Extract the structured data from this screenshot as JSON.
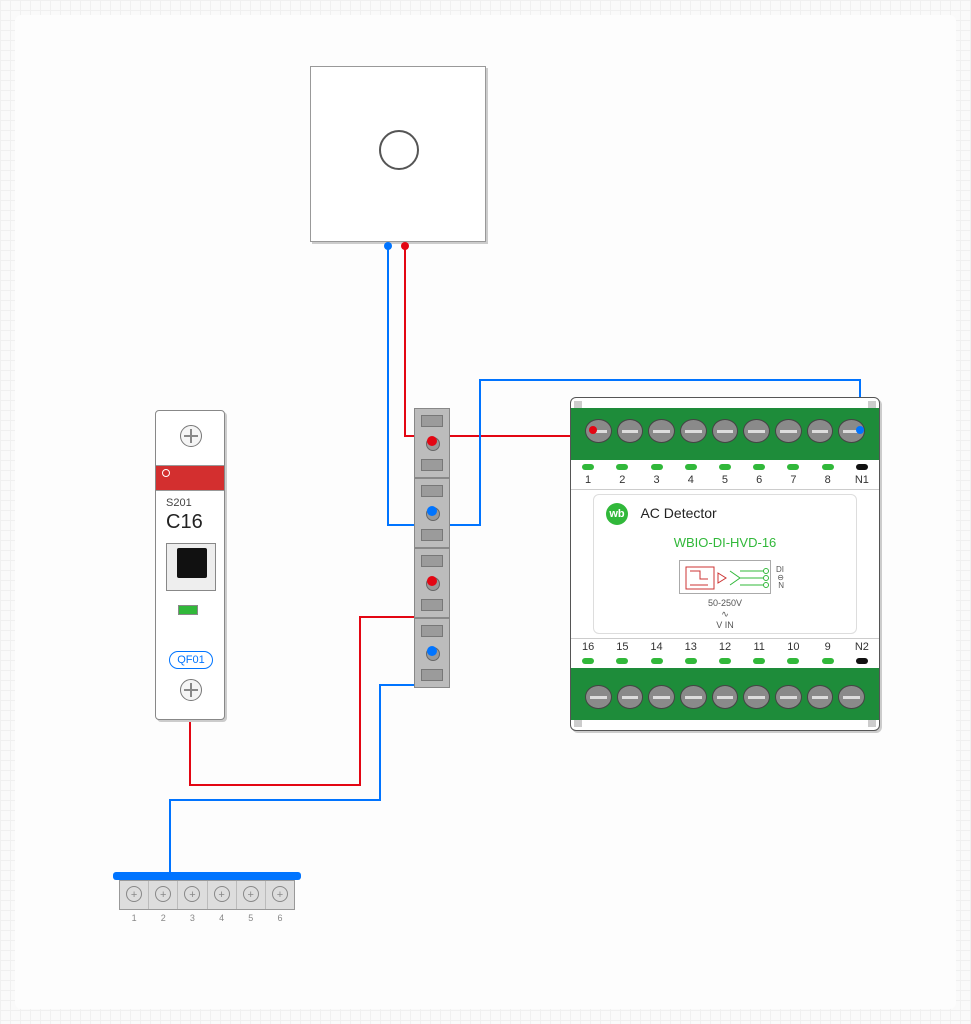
{
  "breaker": {
    "series": "S201",
    "rating": "C16",
    "tag": "QF01"
  },
  "wbio": {
    "logo": "wb",
    "title": "AC Detector",
    "model": "WBIO-DI-HVD-16",
    "voltage_range": "50-250V",
    "ac_symbol": "∿",
    "vin_label": "V IN",
    "opto_labels": {
      "di": "DI",
      "minus": "⊖",
      "n": "N"
    },
    "top_terminals": [
      "1",
      "2",
      "3",
      "4",
      "5",
      "6",
      "7",
      "8",
      "N1"
    ],
    "bottom_terminals": [
      "16",
      "15",
      "14",
      "13",
      "12",
      "11",
      "10",
      "9",
      "N2"
    ]
  },
  "busbar": {
    "positions": [
      "1",
      "2",
      "3",
      "4",
      "5",
      "6"
    ]
  },
  "wiring": {
    "description": "Illustrative wiring: circuit breaker QF01 feeds phase (red) to DIN pass-through terminals; push-button switch (top box) switches phase to WBIO-DI-HVD-16 input 1; neutral (blue) returns via bus bar and pass-through terminals to WBIO N1.",
    "phase_color": "#e30613",
    "neutral_color": "#0074ff"
  }
}
